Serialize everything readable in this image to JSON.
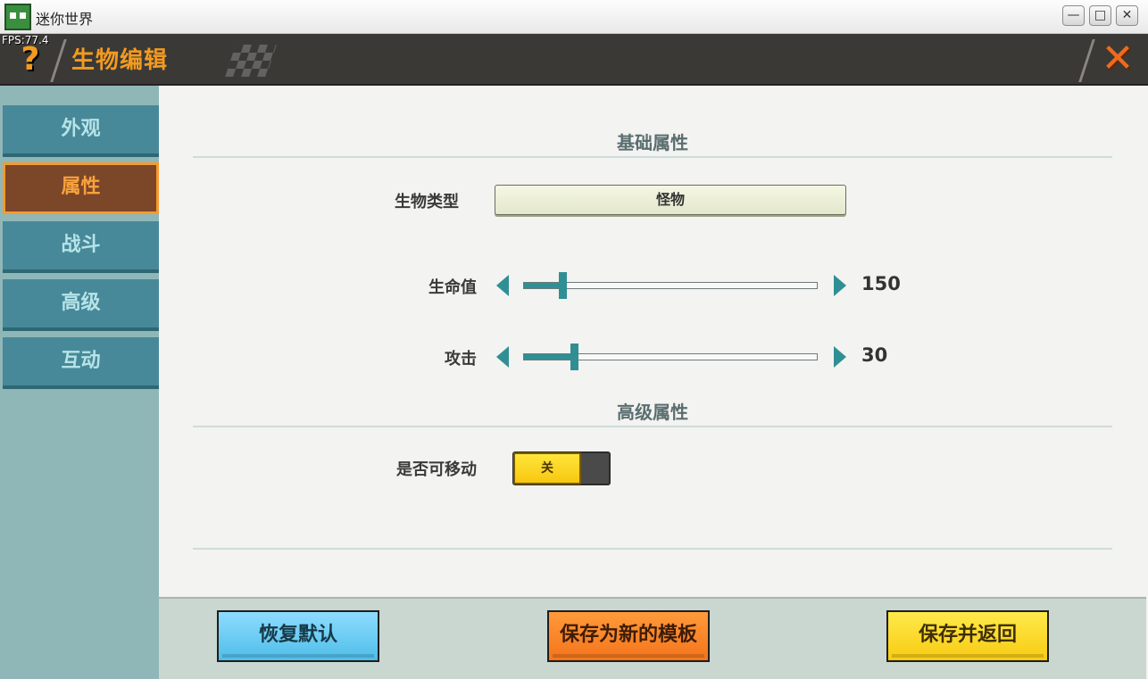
{
  "window": {
    "title": "迷你世界",
    "buttons": {
      "minimize": "—",
      "maximize": "□",
      "close": "✕"
    }
  },
  "header": {
    "fps": "FPS:77.4",
    "help": "?",
    "title": "生物编辑",
    "close": "✕"
  },
  "sidebar": {
    "active": "属性",
    "items": [
      {
        "label": "外观"
      },
      {
        "label": "属性"
      },
      {
        "label": "战斗"
      },
      {
        "label": "高级"
      },
      {
        "label": "互动"
      }
    ]
  },
  "main": {
    "basic_section": "基础属性",
    "creature_type": {
      "label": "生物类型",
      "value": "怪物"
    },
    "health": {
      "label": "生命值",
      "value": "150",
      "slider_fraction": 0.13
    },
    "attack": {
      "label": "攻击",
      "value": "30",
      "slider_fraction": 0.17
    },
    "advanced_section": "高级属性",
    "movable": {
      "label": "是否可移动",
      "state": "关"
    }
  },
  "footer": {
    "restore_label": "恢复默认",
    "save_template_label": "保存为新的模板",
    "save_return_label": "保存并返回"
  },
  "colors": {
    "accent_orange": "#f39a20",
    "teal": "#2f8f94",
    "sidebar_tab": "#478998",
    "sidebar_active": "#7c4628"
  }
}
